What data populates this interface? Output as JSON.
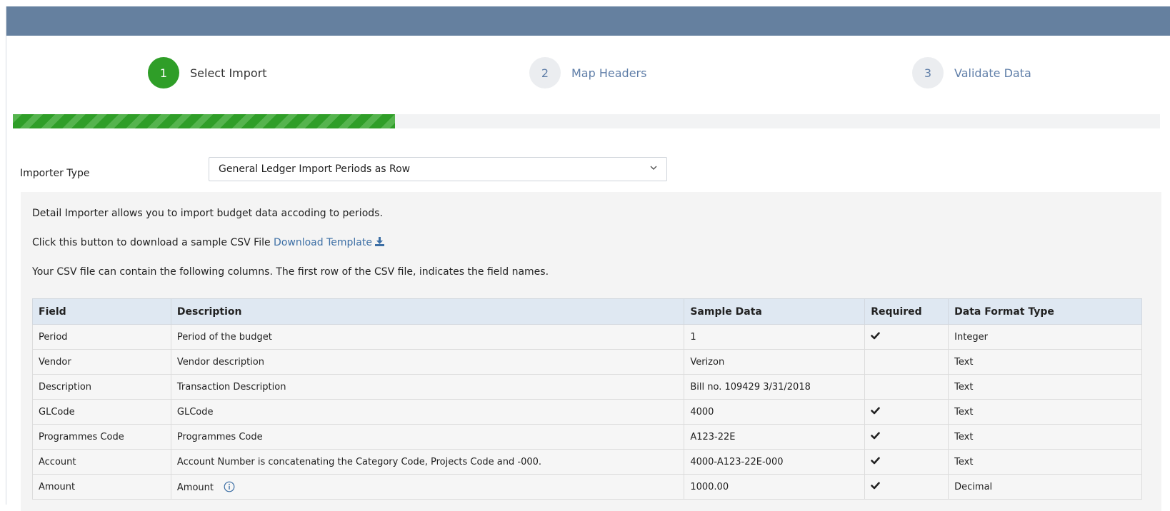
{
  "wizard": {
    "steps": [
      {
        "number": "1",
        "label": "Select Import",
        "state": "active"
      },
      {
        "number": "2",
        "label": "Map Headers",
        "state": "inactive"
      },
      {
        "number": "3",
        "label": "Validate Data",
        "state": "inactive"
      }
    ],
    "progress_fraction": 0.333
  },
  "importer": {
    "label": "Importer Type",
    "selected": "General Ledger Import Periods as Row"
  },
  "info": {
    "line1": "Detail Importer allows you to import budget data accoding to periods.",
    "line2_prefix": "Click this button to download a sample CSV File",
    "download_link": "Download Template",
    "line3": "Your CSV file can contain the following columns. The first row of the CSV file, indicates the field names."
  },
  "table": {
    "headers": [
      "Field",
      "Description",
      "Sample Data",
      "Required",
      "Data Format Type"
    ],
    "rows": [
      {
        "field": "Period",
        "description": "Period of the budget",
        "sample": "1",
        "required": true,
        "format": "Integer"
      },
      {
        "field": "Vendor",
        "description": "Vendor description",
        "sample": "Verizon",
        "required": false,
        "format": "Text"
      },
      {
        "field": "Description",
        "description": "Transaction Description",
        "sample": "Bill no. 109429 3/31/2018",
        "required": false,
        "format": "Text"
      },
      {
        "field": "GLCode",
        "description": "GLCode",
        "sample": "4000",
        "required": true,
        "format": "Text"
      },
      {
        "field": "Programmes Code",
        "description": "Programmes Code",
        "sample": "A123-22E",
        "required": true,
        "format": "Text"
      },
      {
        "field": "Account",
        "description": "Account Number is concatenating the Category Code, Projects Code and -000.",
        "sample": "4000-A123-22E-000",
        "required": true,
        "format": "Text"
      },
      {
        "field": "Amount",
        "description": "Amount",
        "sample": "1000.00",
        "required": true,
        "format": "Decimal",
        "info_icon": true
      }
    ]
  },
  "colors": {
    "header_bar": "#65809f",
    "active_step": "#2f9e28",
    "link": "#3d6fa5"
  }
}
